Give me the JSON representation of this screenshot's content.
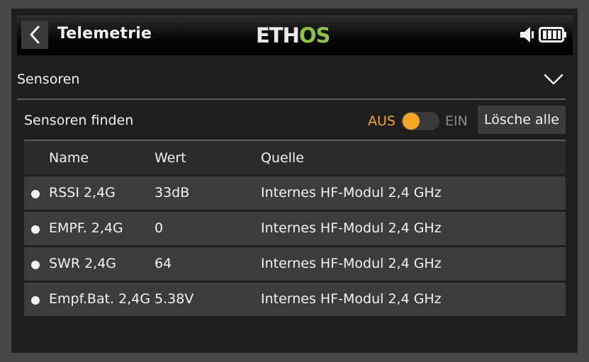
{
  "header": {
    "title": "Telemetrie",
    "logo_main": "ETH",
    "logo_accent": "OS"
  },
  "section": {
    "label": "Sensoren"
  },
  "find": {
    "label": "Sensoren finden",
    "toggle_off_label": "AUS",
    "toggle_on_label": "EIN",
    "toggle_state": "off",
    "clear_button": "Lösche alle"
  },
  "table": {
    "columns": [
      "Name",
      "Wert",
      "Quelle"
    ],
    "rows": [
      {
        "name": "RSSI  2,4G",
        "value": "33dB",
        "source": "Internes HF-Modul 2,4 GHz"
      },
      {
        "name": "EMPF. 2,4G",
        "value": "0",
        "source": "Internes HF-Modul 2,4 GHz"
      },
      {
        "name": "SWR 2,4G",
        "value": "64",
        "source": "Internes HF-Modul 2,4 GHz"
      },
      {
        "name": "Empf.Bat. 2,4G",
        "value": "5.38V",
        "source": "Internes HF-Modul 2,4 GHz"
      }
    ]
  },
  "colors": {
    "accent_orange": "#f5a623",
    "logo_green": "#8bc43f"
  },
  "icons": {
    "back": "chevron-left-icon",
    "volume": "speaker-icon",
    "battery": "battery-icon",
    "expand": "chevron-down-icon"
  }
}
